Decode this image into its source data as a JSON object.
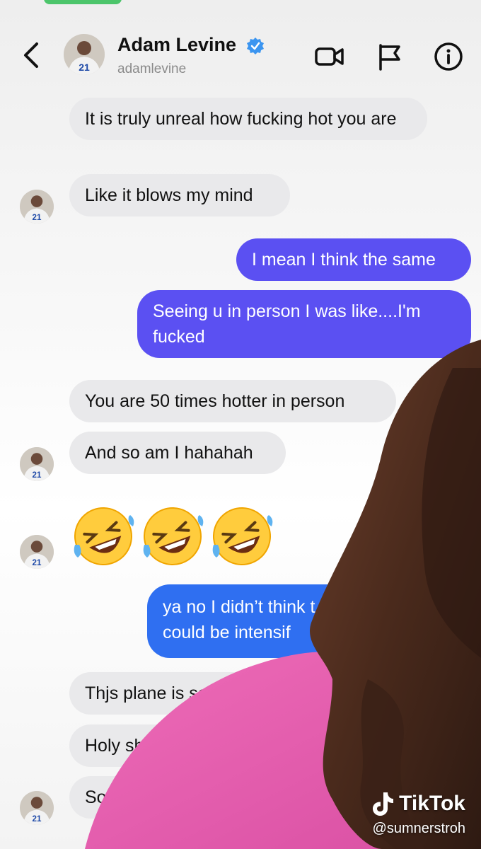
{
  "header": {
    "name": "Adam Levine",
    "handle": "adamlevine"
  },
  "messages": [
    {
      "dir": "in",
      "text": "It is truly unreal how fucking hot you are"
    },
    {
      "dir": "in",
      "text": "Like it blows my mind"
    },
    {
      "dir": "out",
      "text": "I mean I think the same"
    },
    {
      "dir": "out",
      "text": "Seeing u in person I was like....I'm fucked"
    },
    {
      "dir": "in",
      "text": "You are 50 times hotter in person"
    },
    {
      "dir": "in",
      "text": "And so am I hahahah"
    },
    {
      "dir": "in",
      "text": "ya no I didn't think t",
      "alt": "placeholder"
    },
    {
      "dir": "out",
      "text_line1": "ya no I didn’t think t",
      "text_line2": "could be intensif"
    },
    {
      "dir": "in",
      "text": "Thjs plane is so f"
    },
    {
      "dir": "in",
      "text": "Holy shit"
    },
    {
      "dir": "in",
      "text": "Sorry to"
    }
  ],
  "emoji_row": [
    "rolling-on-floor-laughing",
    "rolling-on-floor-laughing",
    "rolling-on-floor-laughing"
  ],
  "watermark": {
    "brand": "TikTok",
    "handle": "@sumnerstroh"
  },
  "colors": {
    "incoming_bubble": "#e9e9eb",
    "outgoing_bubble": "#5b50f2",
    "outgoing_bubble_blue": "#2f6ff1",
    "verified": "#3b95f0"
  }
}
